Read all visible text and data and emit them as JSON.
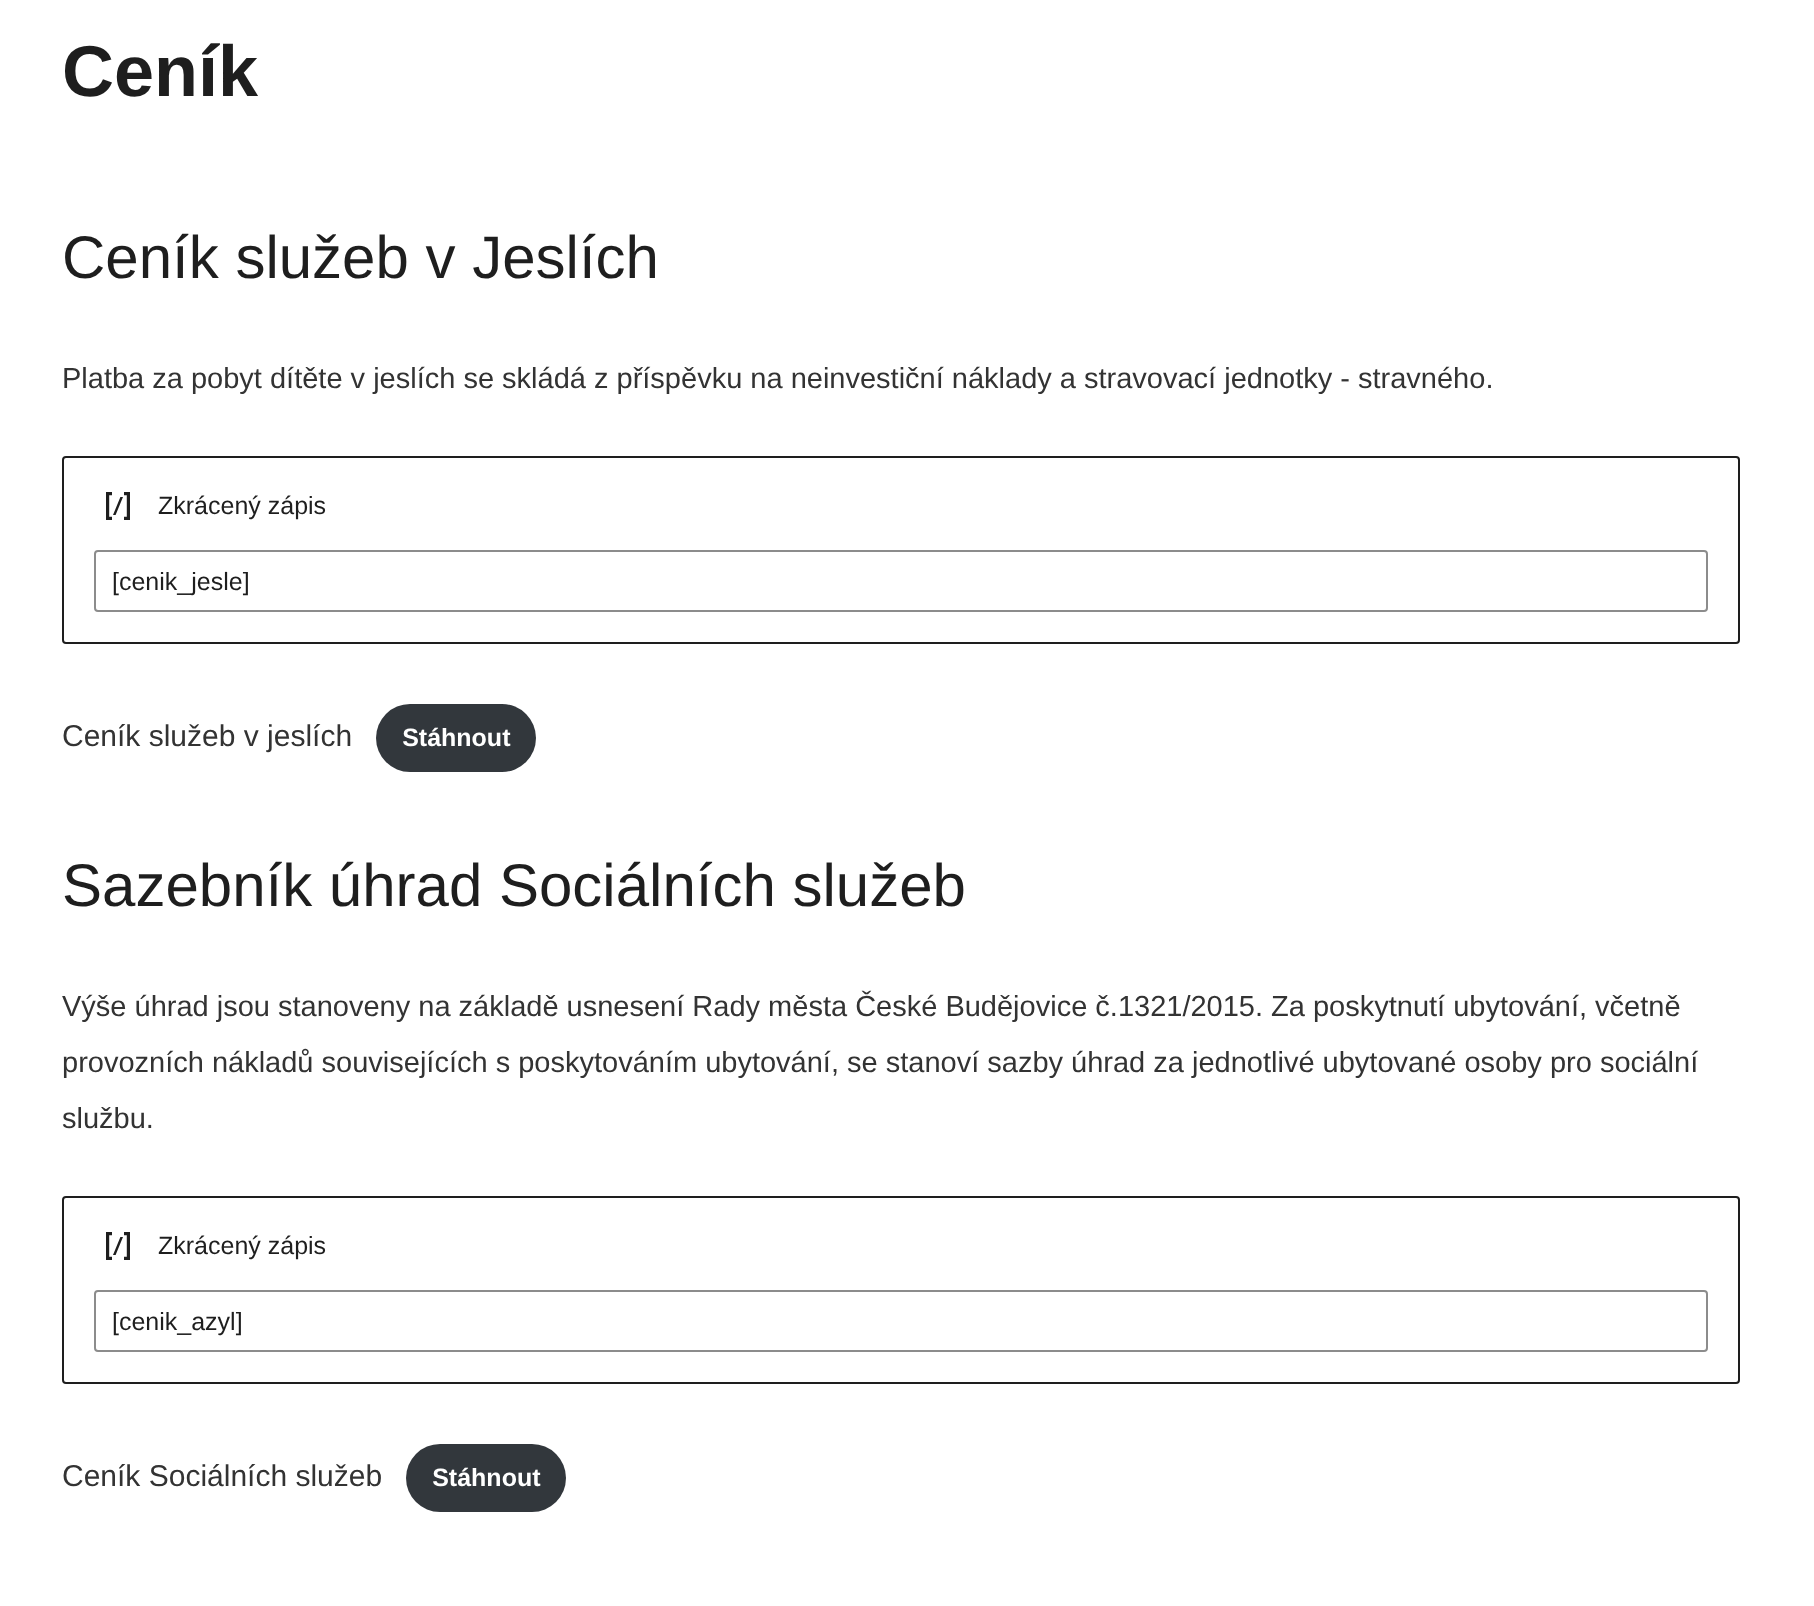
{
  "page_title": "Ceník",
  "sections": [
    {
      "heading": "Ceník služeb v Jeslích",
      "text": "Platba za pobyt dítěte v jeslích se skládá z příspěvku na neinvestiční náklady a stravovací jednotky - stravného.",
      "block": {
        "label": "Zkrácený zápis",
        "value": "[cenik_jesle]"
      },
      "file": {
        "name": "Ceník služeb v jeslích",
        "button": "Stáhnout"
      }
    },
    {
      "heading": "Sazebník úhrad Sociálních služeb",
      "text": "Výše úhrad jsou stanoveny na základě usnesení Rady města České Budějovice č.1321/2015. Za poskytnutí ubytování, včetně provozních nákladů souvisejících s poskytováním ubytování, se stanoví sazby úhrad za jednotlivé ubytované osoby pro sociální službu.",
      "block": {
        "label": "Zkrácený zápis",
        "value": "[cenik_azyl]"
      },
      "file": {
        "name": "Ceník Sociálních služeb",
        "button": "Stáhnout"
      }
    }
  ]
}
